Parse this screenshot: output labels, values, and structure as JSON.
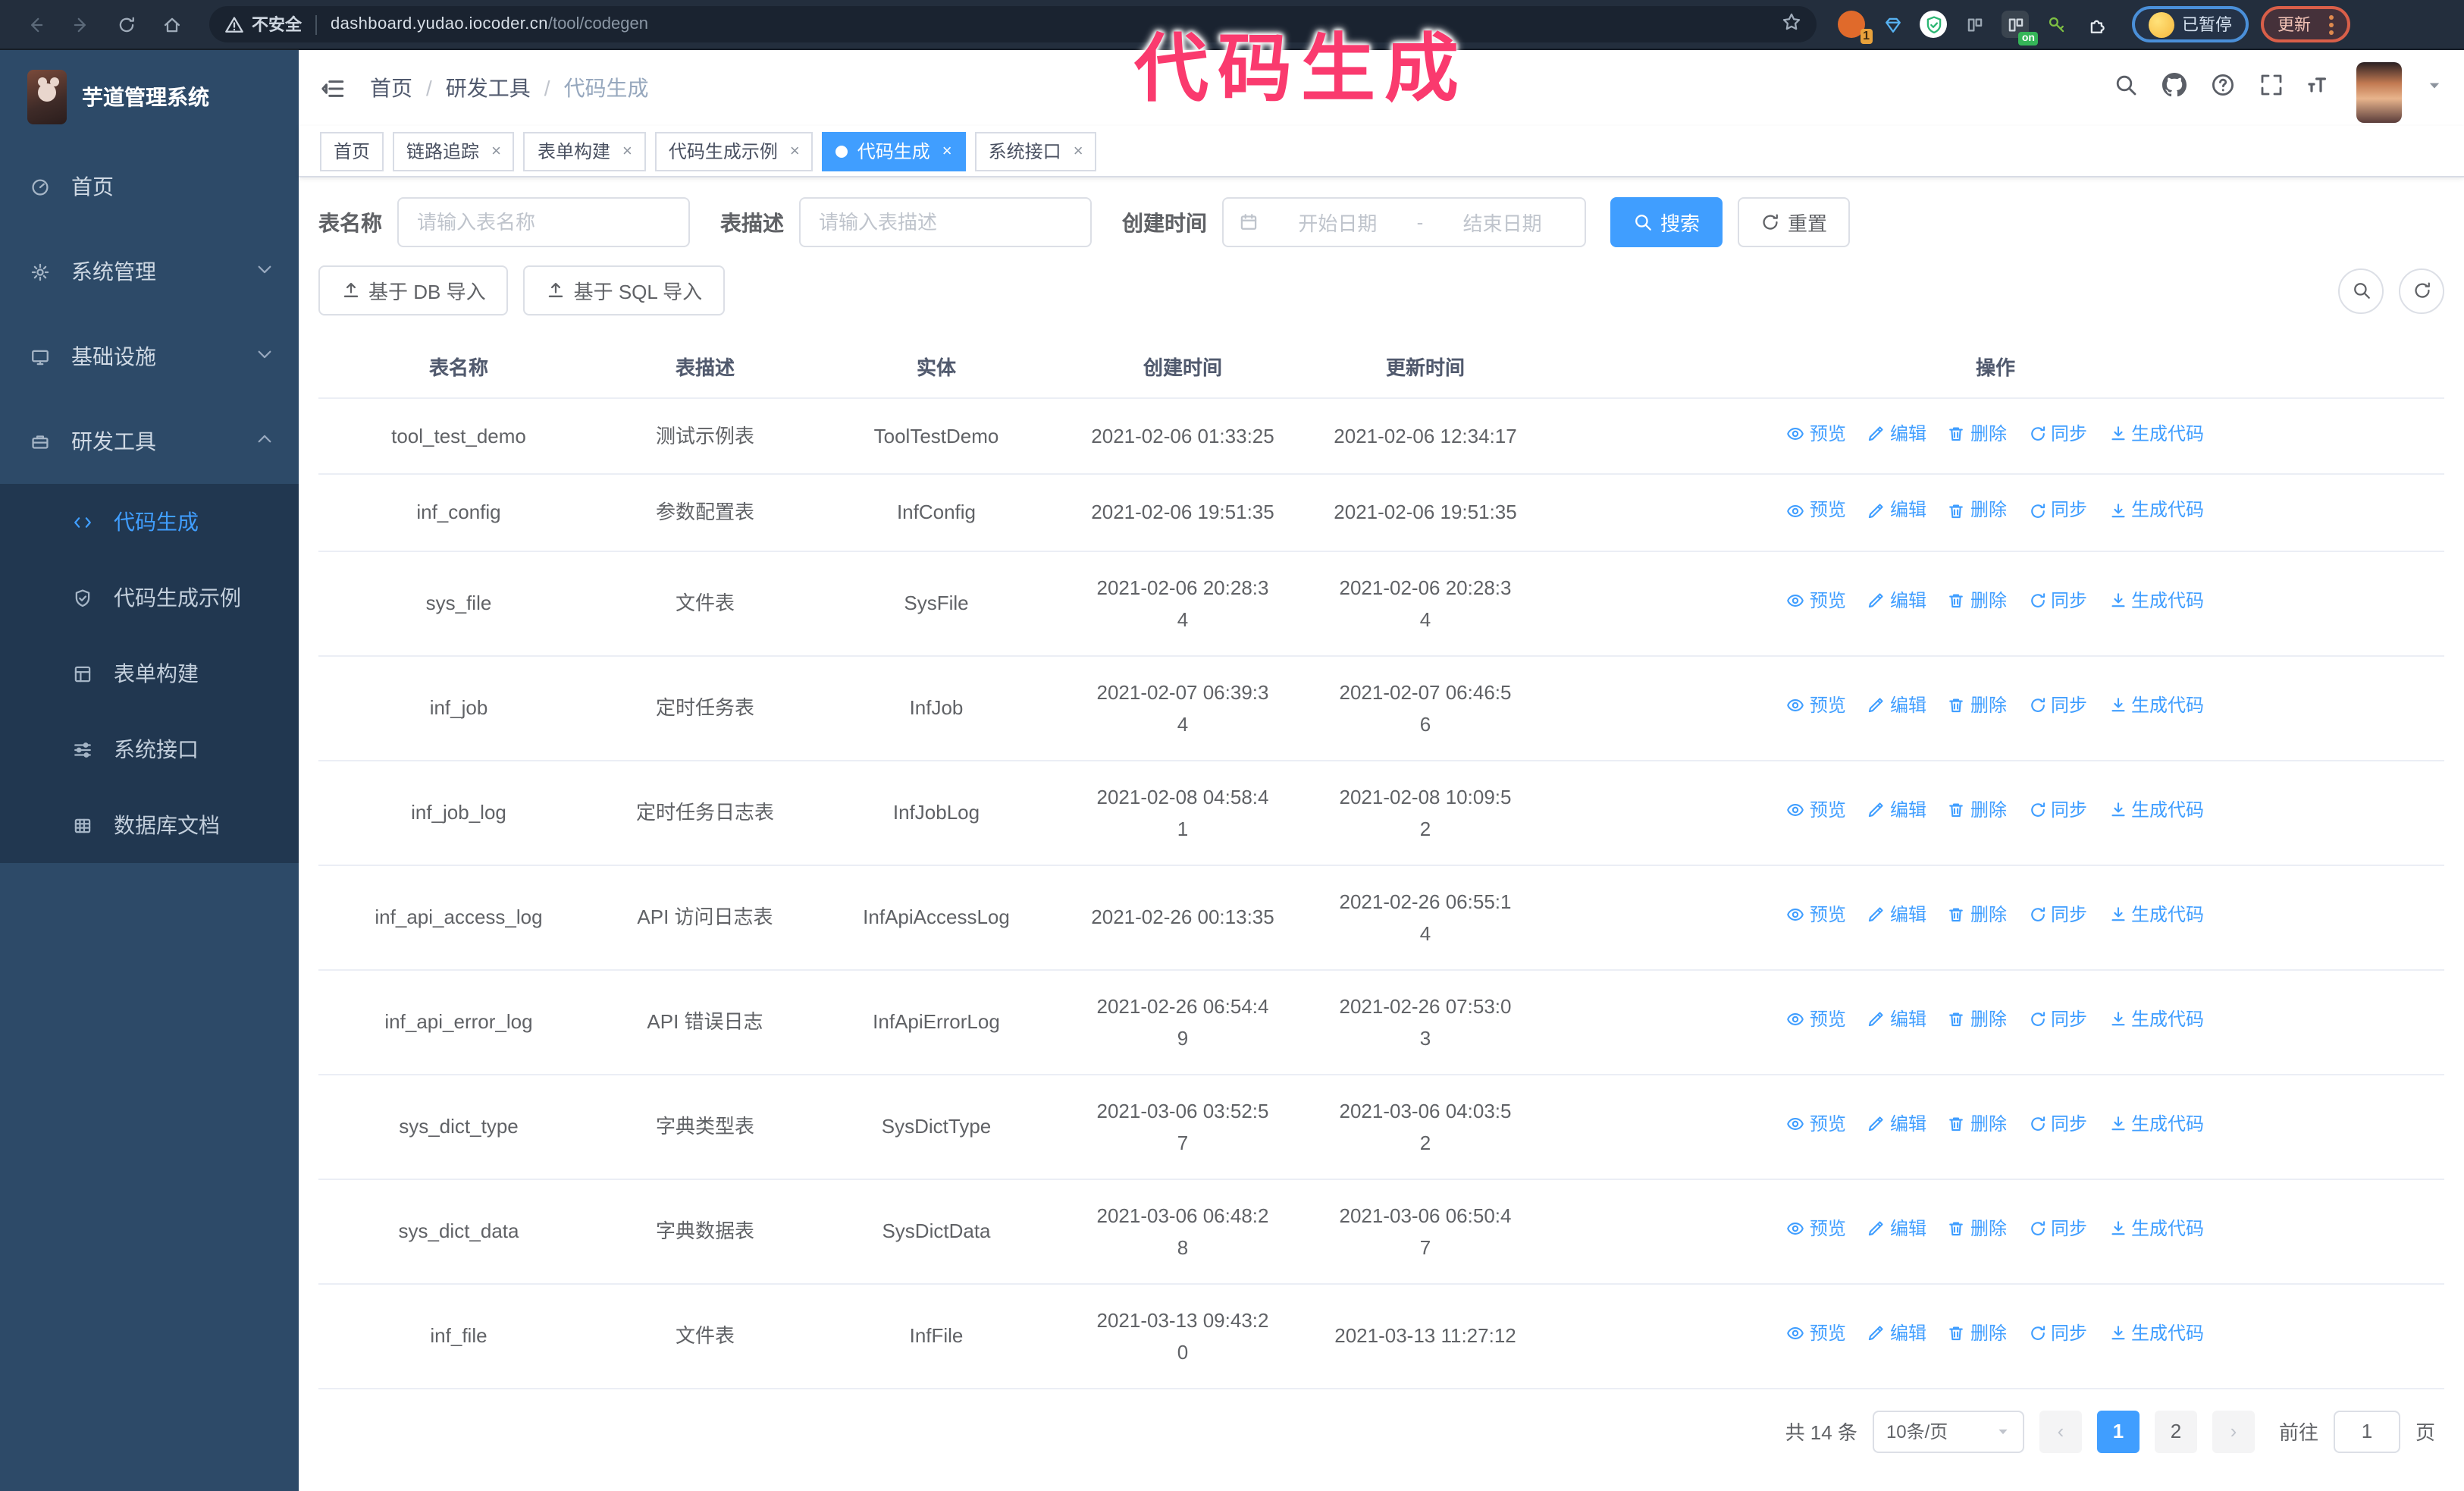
{
  "browser": {
    "security_label": "不安全",
    "url_host": "dashboard.yudao.iocoder.cn",
    "url_path": "/tool/codegen",
    "extension_badge_1": "1",
    "extension_badge_on": "on",
    "paused_badge": "已暂停",
    "update_button": "更新"
  },
  "annotation": {
    "text": "代码生成"
  },
  "sidebar": {
    "title": "芋道管理系统",
    "items": [
      {
        "label": "首页"
      },
      {
        "label": "系统管理"
      },
      {
        "label": "基础设施"
      },
      {
        "label": "研发工具"
      }
    ],
    "submenu": [
      {
        "label": "代码生成",
        "active": true
      },
      {
        "label": "代码生成示例"
      },
      {
        "label": "表单构建"
      },
      {
        "label": "系统接口"
      },
      {
        "label": "数据库文档"
      }
    ]
  },
  "header": {
    "breadcrumb": [
      "首页",
      "研发工具",
      "代码生成"
    ]
  },
  "tabs": [
    {
      "label": "首页",
      "closable": false,
      "active": false
    },
    {
      "label": "链路追踪",
      "closable": true,
      "active": false
    },
    {
      "label": "表单构建",
      "closable": true,
      "active": false
    },
    {
      "label": "代码生成示例",
      "closable": true,
      "active": false
    },
    {
      "label": "代码生成",
      "closable": true,
      "active": true
    },
    {
      "label": "系统接口",
      "closable": true,
      "active": false
    }
  ],
  "filters": {
    "name_label": "表名称",
    "name_placeholder": "请输入表名称",
    "desc_label": "表描述",
    "desc_placeholder": "请输入表描述",
    "time_label": "创建时间",
    "start_placeholder": "开始日期",
    "range_separator": "-",
    "end_placeholder": "结束日期",
    "search_label": "搜索",
    "reset_label": "重置"
  },
  "toolbar": {
    "import_db_label": "基于 DB 导入",
    "import_sql_label": "基于 SQL 导入"
  },
  "table": {
    "columns": [
      "表名称",
      "表描述",
      "实体",
      "创建时间",
      "更新时间",
      "操作"
    ],
    "action_labels": [
      "预览",
      "编辑",
      "删除",
      "同步",
      "生成代码"
    ],
    "rows": [
      {
        "name": "tool_test_demo",
        "desc": "测试示例表",
        "entity": "ToolTestDemo",
        "created": "2021-02-06 01:33:25",
        "updated": "2021-02-06 12:34:17"
      },
      {
        "name": "inf_config",
        "desc": "参数配置表",
        "entity": "InfConfig",
        "created": "2021-02-06 19:51:35",
        "updated": "2021-02-06 19:51:35"
      },
      {
        "name": "sys_file",
        "desc": "文件表",
        "entity": "SysFile",
        "created": "2021-02-06 20:28:3\n4",
        "updated": "2021-02-06 20:28:3\n4"
      },
      {
        "name": "inf_job",
        "desc": "定时任务表",
        "entity": "InfJob",
        "created": "2021-02-07 06:39:3\n4",
        "updated": "2021-02-07 06:46:5\n6"
      },
      {
        "name": "inf_job_log",
        "desc": "定时任务日志表",
        "entity": "InfJobLog",
        "created": "2021-02-08 04:58:4\n1",
        "updated": "2021-02-08 10:09:5\n2"
      },
      {
        "name": "inf_api_access_log",
        "desc": "API 访问日志表",
        "entity": "InfApiAccessLog",
        "created": "2021-02-26 00:13:35",
        "updated": "2021-02-26 06:55:1\n4"
      },
      {
        "name": "inf_api_error_log",
        "desc": "API 错误日志",
        "entity": "InfApiErrorLog",
        "created": "2021-02-26 06:54:4\n9",
        "updated": "2021-02-26 07:53:0\n3"
      },
      {
        "name": "sys_dict_type",
        "desc": "字典类型表",
        "entity": "SysDictType",
        "created": "2021-03-06 03:52:5\n7",
        "updated": "2021-03-06 04:03:5\n2"
      },
      {
        "name": "sys_dict_data",
        "desc": "字典数据表",
        "entity": "SysDictData",
        "created": "2021-03-06 06:48:2\n8",
        "updated": "2021-03-06 06:50:4\n7"
      },
      {
        "name": "inf_file",
        "desc": "文件表",
        "entity": "InfFile",
        "created": "2021-03-13 09:43:2\n0",
        "updated": "2021-03-13 11:27:12"
      }
    ]
  },
  "pagination": {
    "total_label": "共 14 条",
    "page_size": "10条/页",
    "pages": [
      "1",
      "2"
    ],
    "active_page": "1",
    "goto_label": "前往",
    "goto_value": "1",
    "page_unit": "页"
  },
  "colors": {
    "primary": "#409EFF",
    "annotation_pink": "#fa3a6e",
    "sidebar_bg": "#2d4a68",
    "submenu_bg": "#213750"
  }
}
